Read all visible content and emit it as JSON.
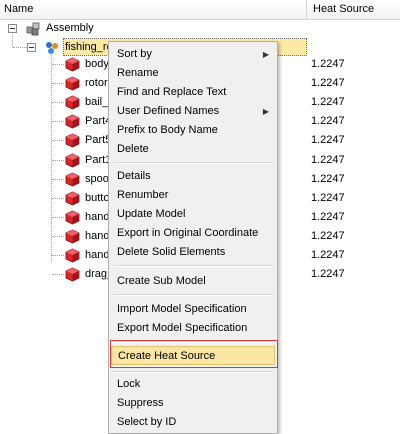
{
  "tree": {
    "columns": {
      "name": "Name",
      "heat_source": "Heat Source"
    },
    "root": {
      "label": "Assembly",
      "icon": "assembly-icon"
    },
    "child": {
      "label": "fishing_re",
      "icon": "model-icon"
    },
    "parts": [
      {
        "label": "body",
        "value": "1.2247"
      },
      {
        "label": "rotor",
        "value": "1.2247"
      },
      {
        "label": "bail_",
        "value": "1.2247"
      },
      {
        "label": "Part4",
        "value": "1.2247"
      },
      {
        "label": "Part5",
        "value": "1.2247"
      },
      {
        "label": "Part1",
        "value": "1.2247"
      },
      {
        "label": "spoo",
        "value": "1.2247"
      },
      {
        "label": "butto",
        "value": "1.2247"
      },
      {
        "label": "hand",
        "value": "1.2247"
      },
      {
        "label": "hand",
        "value": "1.2247"
      },
      {
        "label": "hand",
        "value": "1.2247"
      },
      {
        "label": "drag_",
        "value": "1.2247"
      }
    ],
    "part_icon_color": "#d9262b"
  },
  "context_menu": {
    "items": [
      {
        "label": "Sort by",
        "submenu": "›"
      },
      {
        "label": "Rename"
      },
      {
        "label": "Find and Replace Text"
      },
      {
        "label": "User Defined Names",
        "submenu": "›"
      },
      {
        "label": "Prefix to Body Name"
      },
      {
        "label": "Delete"
      },
      {
        "label": "Details"
      },
      {
        "label": "Renumber"
      },
      {
        "label": "Update Model"
      },
      {
        "label": "Export in Original Coordinate"
      },
      {
        "label": "Delete Solid Elements"
      },
      {
        "label": "Create Sub Model"
      },
      {
        "label": "Import Model Specification"
      },
      {
        "label": "Export Model Specification"
      },
      {
        "label": "Create Heat Source",
        "highlighted": true
      },
      {
        "label": "Lock"
      },
      {
        "label": "Suppress"
      },
      {
        "label": "Select by ID"
      }
    ],
    "highlight_color": "#fbe6a3",
    "focus_border_color": "#d9393d"
  }
}
